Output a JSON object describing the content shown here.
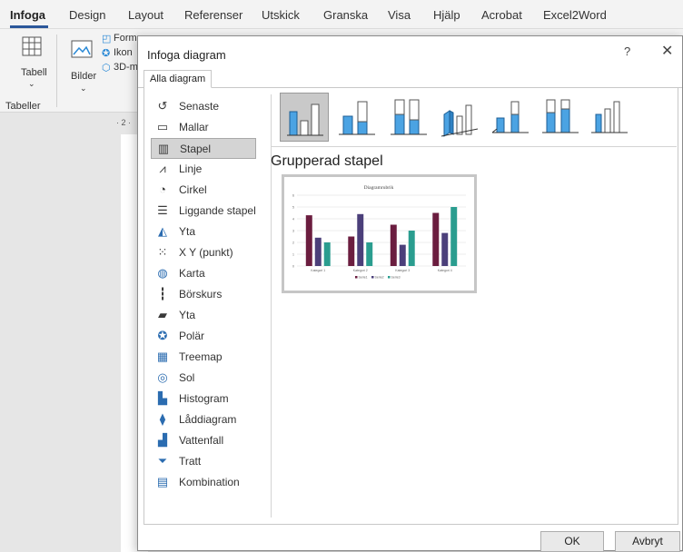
{
  "ribbon": {
    "tabs": [
      "Infoga",
      "Design",
      "Layout",
      "Referenser",
      "Utskick",
      "Granska",
      "Visa",
      "Hjälp",
      "Acrobat",
      "Excel2Word"
    ],
    "table_label": "Tabell",
    "tables_group": "Tabeller",
    "pictures_label": "Bilder",
    "items": [
      "Form",
      "Ikon",
      "3D-m"
    ],
    "ruler": "· 2 ·"
  },
  "dialog": {
    "title": "Infoga diagram",
    "help": "?",
    "close": "✕",
    "tab": "Alla diagram",
    "chart_types": [
      {
        "label": "Senaste",
        "icon": "recent-icon"
      },
      {
        "label": "Mallar",
        "icon": "templates-icon"
      },
      {
        "label": "Stapel",
        "icon": "column-chart-icon"
      },
      {
        "label": "Linje",
        "icon": "line-chart-icon"
      },
      {
        "label": "Cirkel",
        "icon": "pie-chart-icon"
      },
      {
        "label": "Liggande stapel",
        "icon": "bar-chart-icon"
      },
      {
        "label": "Yta",
        "icon": "area-chart-icon"
      },
      {
        "label": "X Y (punkt)",
        "icon": "scatter-chart-icon"
      },
      {
        "label": "Karta",
        "icon": "map-chart-icon"
      },
      {
        "label": "Börskurs",
        "icon": "stock-chart-icon"
      },
      {
        "label": "Yta",
        "icon": "surface-chart-icon"
      },
      {
        "label": "Polär",
        "icon": "radar-chart-icon"
      },
      {
        "label": "Treemap",
        "icon": "treemap-chart-icon"
      },
      {
        "label": "Sol",
        "icon": "sunburst-chart-icon"
      },
      {
        "label": "Histogram",
        "icon": "histogram-chart-icon"
      },
      {
        "label": "Låddiagram",
        "icon": "boxwhisker-chart-icon"
      },
      {
        "label": "Vattenfall",
        "icon": "waterfall-chart-icon"
      },
      {
        "label": "Tratt",
        "icon": "funnel-chart-icon"
      },
      {
        "label": "Kombination",
        "icon": "combo-chart-icon"
      }
    ],
    "selected_type": "Stapel",
    "subtype_name": "Grupperad stapel",
    "ok": "OK",
    "cancel": "Avbryt",
    "colors": {
      "accent": "#2b579a",
      "icon_blue": "#4ba3e3",
      "selected_bg": "#c9c9c9"
    }
  },
  "chart_data": {
    "type": "bar",
    "title": "Diagramrubrik",
    "categories": [
      "Kategori 1",
      "Kategori 2",
      "Kategori 3",
      "Kategori 4"
    ],
    "series": [
      {
        "name": "Serie1",
        "values": [
          4.3,
          2.5,
          3.5,
          4.5
        ],
        "color": "#6b1d3f"
      },
      {
        "name": "Serie2",
        "values": [
          2.4,
          4.4,
          1.8,
          2.8
        ],
        "color": "#4b3f7a"
      },
      {
        "name": "Serie3",
        "values": [
          2,
          2,
          3,
          5
        ],
        "color": "#2a9d8f"
      }
    ],
    "ylim": [
      0,
      6
    ],
    "yticks": [
      "0",
      "1",
      "2",
      "3",
      "4",
      "5",
      "6"
    ],
    "grid": true,
    "legend": "bottom"
  }
}
